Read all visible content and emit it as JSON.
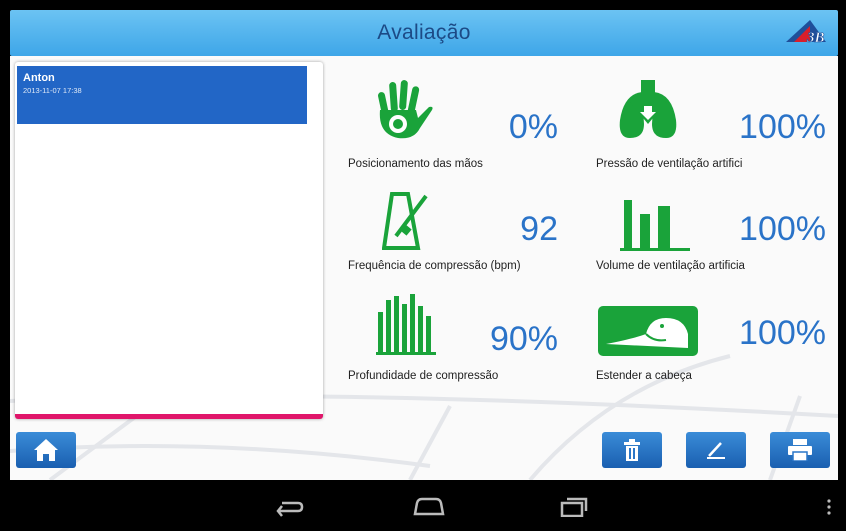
{
  "header": {
    "title": "Avaliação",
    "logo_text": "3B",
    "logo_icon": "3b-scientific-logo"
  },
  "sessions": [
    {
      "name": "Anton",
      "date": "2013-11-07 17:38"
    }
  ],
  "metrics": [
    {
      "icon": "hand-icon",
      "value": "0%",
      "label": "Posicionamento das mãos"
    },
    {
      "icon": "lungs-icon",
      "value": "100%",
      "label": "Pressão de ventilação artifici"
    },
    {
      "icon": "metronome-icon",
      "value": "92",
      "label": "Frequência de compressão (bpm)"
    },
    {
      "icon": "volume-bars-icon",
      "value": "100%",
      "label": "Volume de ventilação artificia"
    },
    {
      "icon": "depth-bars-icon",
      "value": "90%",
      "label": "Profundidade de compressão"
    },
    {
      "icon": "head-tilt-icon",
      "value": "100%",
      "label": "Estender a cabeça"
    }
  ],
  "toolbar": {
    "home_icon": "home-icon",
    "delete_icon": "trash-icon",
    "edit_icon": "pen-icon",
    "print_icon": "printer-icon"
  },
  "navbar": {
    "back_icon": "back-icon",
    "home_icon": "android-home-icon",
    "recents_icon": "recents-icon",
    "menu_icon": "overflow-menu-icon"
  },
  "colors": {
    "header": "#4fb2ee",
    "title": "#1c4a86",
    "selected_row": "#2266c6",
    "accent_bar": "#e0166a",
    "icon_green": "#1aa33a",
    "value_blue": "#2a73c8",
    "button_blue": "#2a76c8"
  }
}
